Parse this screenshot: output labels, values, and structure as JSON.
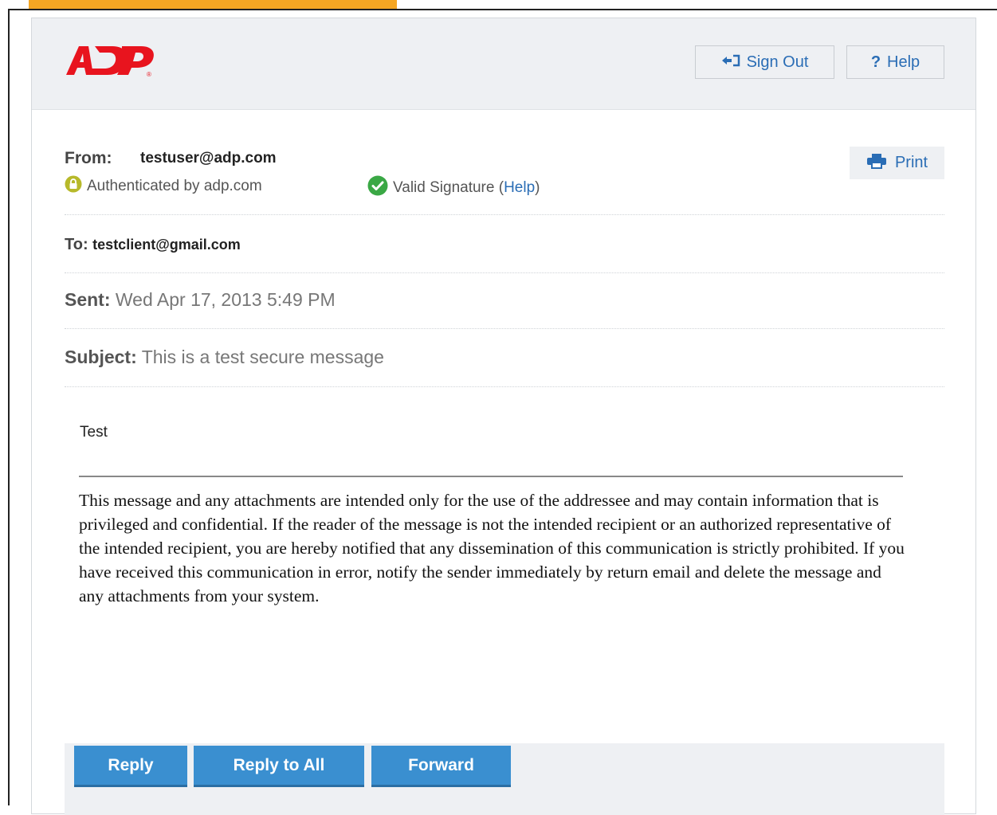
{
  "header": {
    "logo_text": "ADP",
    "sign_out_label": "Sign Out",
    "help_label": "Help",
    "sign_out_icon": "sign-out-icon",
    "help_icon": "question-icon"
  },
  "message": {
    "from_label": "From:",
    "from_value": "testuser@adp.com",
    "authenticated_text": "Authenticated by adp.com",
    "signature_text": "Valid Signature (",
    "signature_help_link": "Help",
    "signature_text_end": ")",
    "print_label": "Print",
    "to_label": "To:",
    "to_value": "testclient@gmail.com",
    "sent_label": "Sent:",
    "sent_value": "Wed Apr 17, 2013 5:49 PM",
    "subject_label": "Subject:",
    "subject_value": "This is a test secure message",
    "body_text": "Test",
    "disclaimer": "This message and any attachments are intended only for the use of the addressee and may contain information that is privileged and confidential. If the reader of the message is not the intended recipient or an authorized representative of the intended recipient, you are hereby notified that any dissemination of this communication is strictly prohibited. If you have received this communication in error, notify the sender immediately by return email and delete the message and any attachments from your system."
  },
  "actions": {
    "reply_label": "Reply",
    "reply_all_label": "Reply to All",
    "forward_label": "Forward"
  },
  "colors": {
    "accent": "#f5a623",
    "link": "#2a6db5",
    "button": "#3a8fd0",
    "brand_red": "#e8141e",
    "auth_lock": "#b7b92a",
    "valid_check": "#3aa845"
  }
}
